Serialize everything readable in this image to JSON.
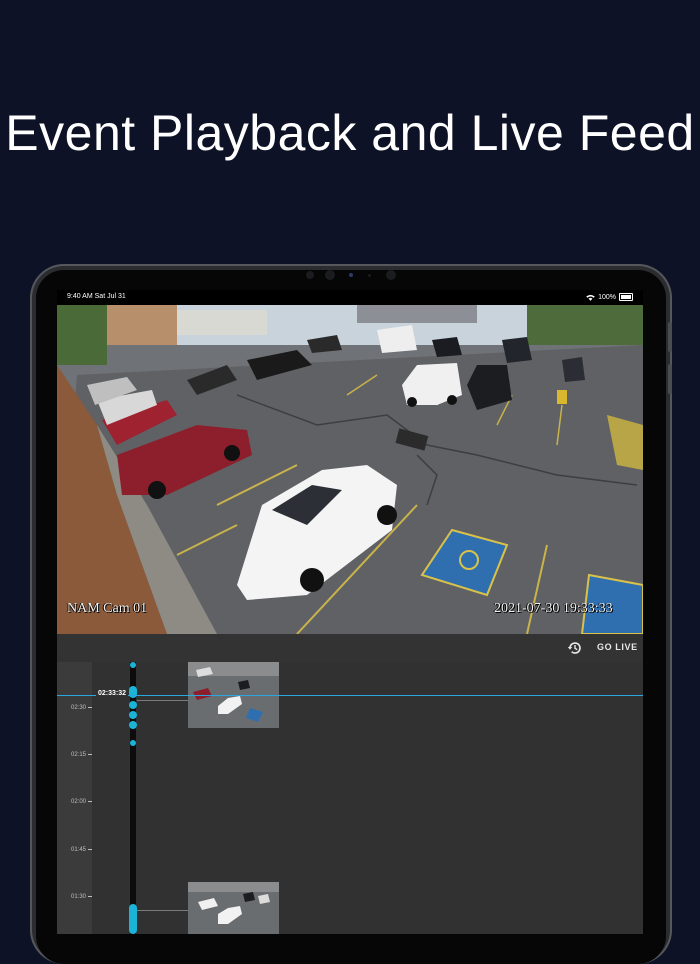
{
  "headline": "Event Playback and Live Feed",
  "status_bar": {
    "time": "9:40 AM  Sat Jul 31",
    "battery": "100%"
  },
  "video": {
    "camera_name": "NAM Cam 01",
    "timestamp": "2021-07-30 19:33:33"
  },
  "toolbar": {
    "history_icon": "history-icon",
    "go_live_label": "GO LIVE"
  },
  "timeline": {
    "playhead_time": "02:33:32",
    "ticks": [
      "02:30",
      "02:15",
      "02:00",
      "01:45",
      "01:30"
    ],
    "accent_color": "#1bb3d6"
  }
}
